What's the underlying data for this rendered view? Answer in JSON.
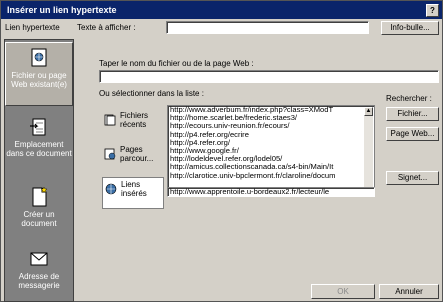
{
  "window": {
    "title": "Insérer un lien hypertexte",
    "help_glyph": "?"
  },
  "link_to_label": "Lien hypertexte",
  "text_to_display": {
    "label": "Texte à afficher :",
    "value": ""
  },
  "screentip_button": "Info-bulle...",
  "sidebar": {
    "items": [
      {
        "label": "Fichier ou page Web existant(e)",
        "icon": "web-page-icon",
        "selected": true
      },
      {
        "label": "Emplacement dans ce document",
        "icon": "document-location-icon",
        "selected": false
      },
      {
        "label": "Créer un document",
        "icon": "new-document-icon",
        "selected": false
      },
      {
        "label": "Adresse de messagerie",
        "icon": "email-icon",
        "selected": false
      }
    ]
  },
  "address": {
    "label": "Taper le nom du fichier ou de la page Web :",
    "value": ""
  },
  "select_from_label": "Ou sélectionner dans la liste :",
  "browse_label": "Rechercher :",
  "browse_buttons": {
    "file": "Fichier...",
    "web": "Page Web..."
  },
  "bookmark_button": "Signet...",
  "tabs": [
    {
      "label": "Fichiers récents",
      "icon": "recent-files-icon",
      "selected": false
    },
    {
      "label": "Pages parcour...",
      "icon": "browsed-pages-icon",
      "selected": false
    },
    {
      "label": "Liens insérés",
      "icon": "inserted-links-icon",
      "selected": true
    }
  ],
  "links": [
    "http://www.adverbum.fr/index.php?class=XModT",
    "http://home.scarlet.be/frederic.staes3/",
    "http://ecours.univ-reunion.fr/ecours/",
    "http://p4.refer.org/ecrire",
    "http://p4.refer.org/",
    "http://www.google.fr/",
    "http://lodeldevel.refer.org/lodel05/",
    "http://amicus.collectionscanada.ca/s4-bin/Main/It",
    "http://clarotice.univ-bpclermont.fr/claroline/docum",
    "http://www.apprentoile.u-bordeaux2.fr/lecteur/le"
  ],
  "ok_button": "OK",
  "cancel_button": "Annuler",
  "colors": {
    "titlebar": "#0a246a",
    "dialog": "#d4d0c8",
    "sidebar": "#808080"
  }
}
